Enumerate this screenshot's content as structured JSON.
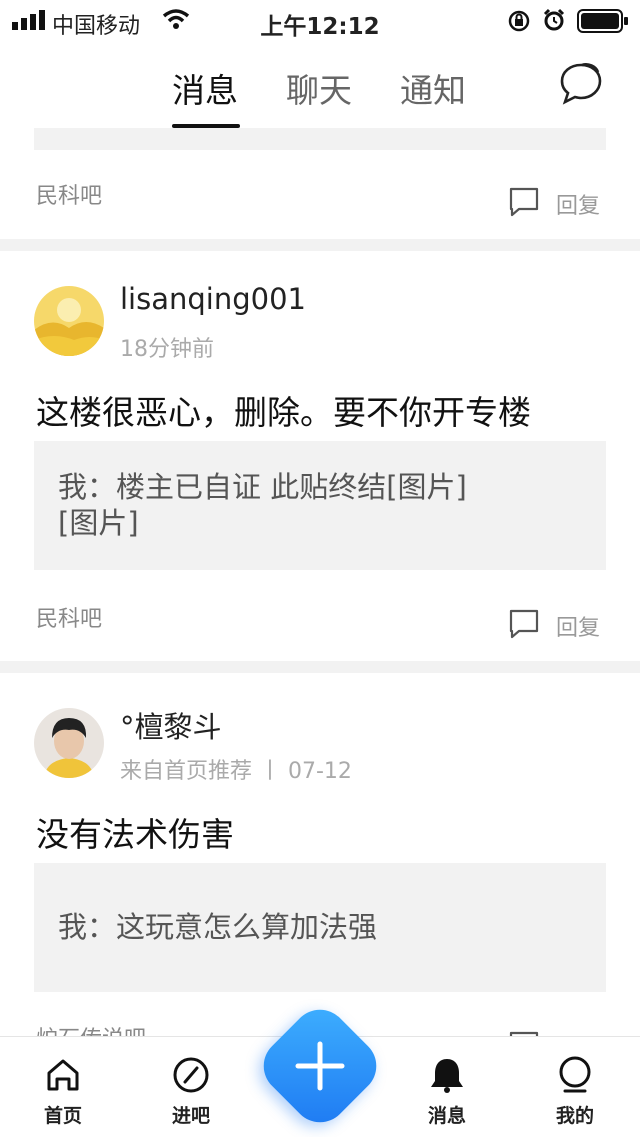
{
  "status_bar": {
    "carrier": "中国移动",
    "time": "上午12:12"
  },
  "top_nav": {
    "tabs": [
      {
        "label": "消息",
        "active": true
      },
      {
        "label": "聊天",
        "active": false
      },
      {
        "label": "通知",
        "active": false
      }
    ]
  },
  "feed": {
    "reply_label": "回复",
    "posts": [
      {
        "forum": "民科吧"
      },
      {
        "username": "lisanqing001",
        "meta": "18分钟前",
        "content": "这楼很恶心，删除。要不你开专楼",
        "quote_line1": "我：楼主已自证 此贴终结[图片]",
        "quote_line2": "[图片]",
        "forum": "民科吧"
      },
      {
        "username": "°檀黎斗",
        "meta": "来自首页推荐 丨 07-12",
        "content": "没有法术伤害",
        "quote_line1": "我：这玩意怎么算加法强",
        "forum": "炉石传说吧"
      }
    ]
  },
  "bottom_nav": {
    "items": [
      {
        "label": "首页",
        "icon": "home-icon"
      },
      {
        "label": "进吧",
        "icon": "compass-icon"
      },
      {
        "label": "消息",
        "icon": "bell-icon"
      },
      {
        "label": "我的",
        "icon": "profile-icon"
      }
    ],
    "fab_icon": "plus-icon",
    "accent_color": "#2a8ef8"
  }
}
